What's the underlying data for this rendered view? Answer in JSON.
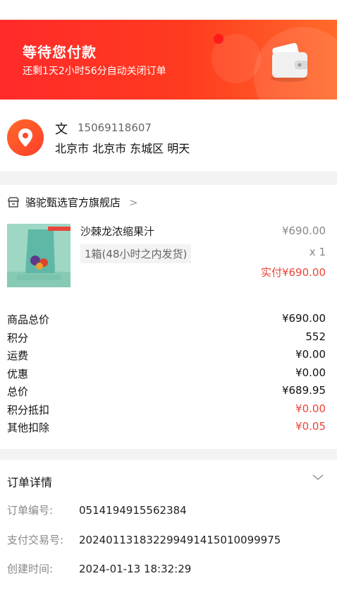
{
  "banner": {
    "title": "等待您付款",
    "subtitle": "还剩1天2小时56分自动关闭订单"
  },
  "address": {
    "name": "文",
    "phone": "15069118607",
    "line": "北京市 北京市 东城区 明天"
  },
  "store": {
    "name": "骆驼甄选官方旗舰店",
    "chevron": ">"
  },
  "product": {
    "name": "沙棘龙浓缩果汁",
    "price": "¥690.00",
    "spec": "1箱(48小时之内发货)",
    "qty": "x 1",
    "paid": "实付¥690.00"
  },
  "summary": [
    {
      "label": "商品总价",
      "value": "¥690.00",
      "red": false
    },
    {
      "label": "积分",
      "value": "552",
      "red": false
    },
    {
      "label": "运费",
      "value": "¥0.00",
      "red": false
    },
    {
      "label": "优惠",
      "value": "¥0.00",
      "red": false
    },
    {
      "label": "总价",
      "value": "¥689.95",
      "red": false
    },
    {
      "label": "积分抵扣",
      "value": "¥0.00",
      "red": true
    },
    {
      "label": "其他扣除",
      "value": "¥0.05",
      "red": true
    }
  ],
  "detail": {
    "title": "订单详情",
    "order_no_label": "订单编号:",
    "order_no": "0514194915562384",
    "trade_no_label": "支付交易号:",
    "trade_no": "2024011318322994914150100999 75",
    "trade_no_exact": "202401131832299491415010099975",
    "created_label": "创建时间:",
    "created": "2024-01-13 18:32:29"
  },
  "icons": {
    "location": "location-pin-icon",
    "store": "store-icon",
    "wallet": "wallet-icon",
    "chevron_down": "chevron-down-icon"
  },
  "colors": {
    "accent": "#ff2a2a",
    "price_red": "#e8463a"
  }
}
